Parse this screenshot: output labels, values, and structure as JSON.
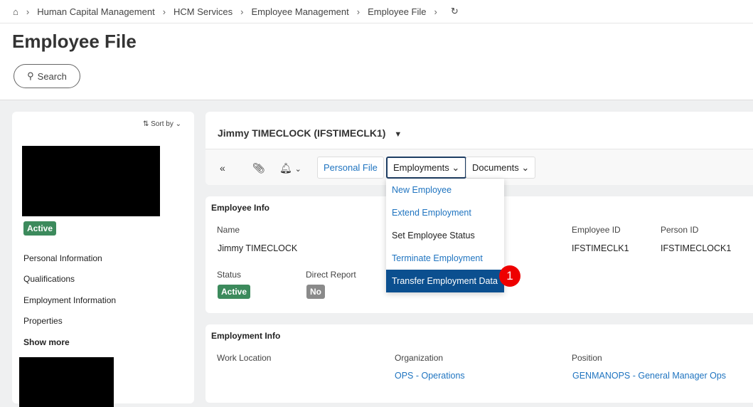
{
  "breadcrumb": [
    "Human Capital Management",
    "HCM Services",
    "Employee Management",
    "Employee File"
  ],
  "page_title": "Employee File",
  "search_label": "Search",
  "left": {
    "sort_label": "Sort by",
    "status": "Active",
    "items": [
      "Personal Information",
      "Qualifications",
      "Employment Information",
      "Properties"
    ],
    "show_more": "Show more"
  },
  "header": {
    "title": "Jimmy TIMECLOCK (IFSTIMECLK1)",
    "personal_file": "Personal File",
    "employments": "Employments",
    "documents": "Documents"
  },
  "menu": {
    "items": [
      "New Employee",
      "Extend Employment",
      "Set Employee Status",
      "Terminate Employment",
      "Transfer Employment Data"
    ]
  },
  "step_badge": "1",
  "employee_info": {
    "title": "Employee Info",
    "name_label": "Name",
    "name": "Jimmy TIMECLOCK",
    "emp_id_label": "Employee ID",
    "emp_id": "IFSTIMECLK1",
    "person_id_label": "Person ID",
    "person_id": "IFSTIMECLOCK1",
    "status_label": "Status",
    "status": "Active",
    "direct_report_label": "Direct Report",
    "direct_report": "No"
  },
  "employment_info": {
    "title": "Employment Info",
    "work_location_label": "Work Location",
    "organization_label": "Organization",
    "organization": "OPS - Operations",
    "position_label": "Position",
    "position": "GENMANOPS - General Manager Ops"
  }
}
